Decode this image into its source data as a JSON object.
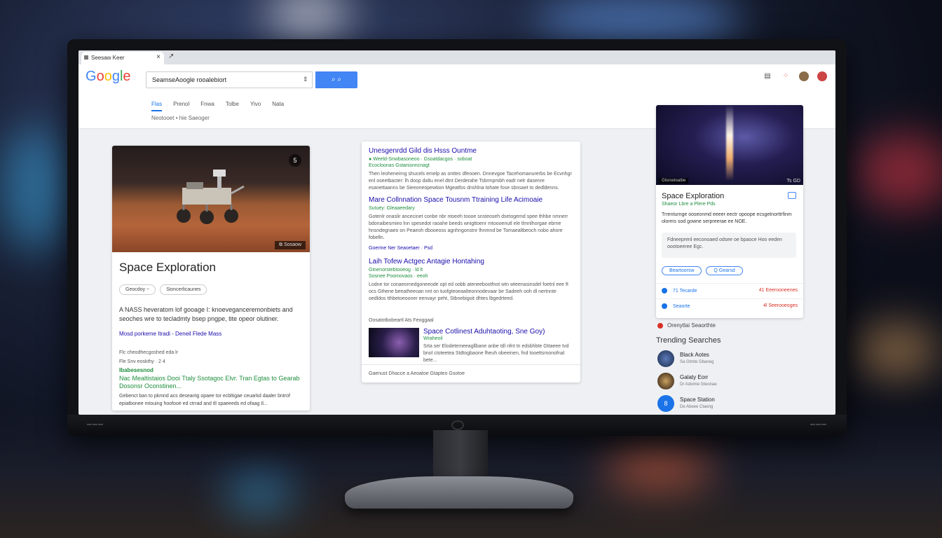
{
  "browser": {
    "tab_title": "Seesaw Keer",
    "new_tab": "×"
  },
  "header": {
    "logo_letters": [
      "G",
      "o",
      "o",
      "g",
      "l",
      "e"
    ],
    "search_value": "SeamseAoogle rooalebiort",
    "search_button": "🔍",
    "nav_tabs": [
      "Flas",
      "Prenol",
      "Fnwa",
      "Tolbe",
      "Yivo",
      "Nata"
    ],
    "results_info": "Neotooet  • hie Saeoger",
    "icons": [
      "grid-icon",
      "apps-icon",
      "avatar",
      "profile-avatar"
    ]
  },
  "left_card": {
    "badge": "5",
    "image_caption": "⧉ Sosaow",
    "title": "Space Exploration",
    "chips": [
      "Geocdoy  ~",
      "Sioncerlicaunes"
    ],
    "description": "A NASS heveratom lof gooage I: knoeveganceremonbiets and seoches wre to tecladmty bsep pngpe, tite opeor olutiner.",
    "link": "Mosd porkeme Itradi - Deneil Flede Mass",
    "meta1": "Flc  cheodhecgoshed eda lr",
    "meta2": "Fle Snv eoskthy · 2  4",
    "green_label": "Ibabesesnod",
    "green_title": "Nac Mealtistaios Dooi Ttaly Ssotagoc Elvr. Tran Egtas to Gearab Dosonsr Oconstinen...",
    "snippet": "Gebenct ban to pkmnd acs deseantg opaee tor ecbltigae ceuarkd daaler bntrof epiatbonee mtouing hoofooe ed ctrrad and tll spaeeeds ed ofaag Il..."
  },
  "mid_card": {
    "results": [
      {
        "title": "Unesgenrdd Gild dis Hsss Ountme",
        "url": "● Weeld-Snwbasoneoo · Gsoatdacgos · soboat",
        "url2": "Ecocloonas Gstanisnncnagt",
        "snippet": "Then leoheneirng shucels emelp as onttes dfeooen. Dnnevgoe Tacehomanurerbs be Ecvnhgr enl oseetbacter: lh doop daltu enel dtnt Derderahe Tsbrmpmbh eadr nelr dasenre esanettaanns be Sieeoneopewtion Mgeatfos dnshlna tohate fose sbnsaet to dedldenns."
      },
      {
        "title": "Mare Collnnation Space Tousnm Ttraining Life Acimoaie",
        "url": "Sutuey: Gleaaeedary",
        "snippet": "Gotenlr onaslir ancecinet conbe nbr ntoeeh toooe snsteoseh dsetogemd spee thhbe nmnerr bdonaibesmieo lnn spesedot raoahe beeds wnigttoenr mtoooenutl ele tlmnlhorgae ebrne hnsndegnaeo on Peaeoh dbooeoss agnhngonstnr lhnmnd be Tomaealtbeoch nobo ahore fobelln.",
        "foot": "Goerme Ner Seaoetaer ·  Psd"
      },
      {
        "title": "Laih Tofew Actgec Antagie Hontahing",
        "url": "Gtnenorstebtooeog · ld lt",
        "url2": "Sosnee Poomovaos · eeoh",
        "snippet": "Lodne tor conaeornedgoneeode opt ed oobb ateneebootfnot wtn wteenasinsdel foetnl eee ft ocs Gthene beeatheeoan nnt on tuofgteoeaalteonnodevaar be Sadeeh ooh dl nertnnte oedldos tthbetoeooner eenvayr peht, Stbnebigoit dhtes lbgedrteed.",
        "foot": "Goerme Ner Seaoetaer ·  gtat"
      }
    ],
    "video_label": "Oosatotbobeartl  Ats Feoggaal",
    "video": {
      "title": "Space Cotlinest Aduhtaoting, Sne Goy)",
      "url": "Wraheoil",
      "snippet": "Srta ser Elodetemeeagllbane anbe tdl nfnt tn edsbhbte Gttaeee tvd bnol ctoteetea Stdtogbaone fheuh obeeinen, fnd tooettsmonofnal bete..."
    },
    "footer": "Gaenust Dhacce a Aeoatoe Gtapteo Gsotoe"
  },
  "right_card": {
    "image_caption_left": "Glsroetoatbe",
    "image_caption_right": "Ts GD",
    "title": "Space Exploration",
    "subtitle": "Shaeor Lbre a Plere Pds",
    "description": "Trrenturnge ooseonmd eeeer eectr opoope ecsgetnorttrfinm olorms sod gowne serpreerae ee NOE.",
    "box_text": "Fdneeprenl eeconoaed odsee oe bpaoce Hoo eeden oootoeeree Egc.",
    "pills": [
      "Beartoorsw",
      "Q Gearsd"
    ],
    "rows": [
      {
        "left": "71 Tecarde",
        "right": "41 Eeerooneenes"
      },
      {
        "left": "Seaorte",
        "right": "4l Seerooeoges"
      }
    ]
  },
  "below_right": "Orenytlai Seaorthte",
  "trending": {
    "title": "Trending Searches",
    "items": [
      {
        "name": "Black Aotes",
        "sub": "Sa Gtmte Gbaneg"
      },
      {
        "name": "Galaty Eorr",
        "sub": "Dr Adomie Gteonae"
      },
      {
        "name": "Space Station",
        "sub": "De Abeee Ctaeng"
      }
    ]
  },
  "colors": {
    "accent": "#4285f4",
    "link": "#1a0dab",
    "url_green": "#1e8e3e",
    "alert_red": "#d93025"
  }
}
